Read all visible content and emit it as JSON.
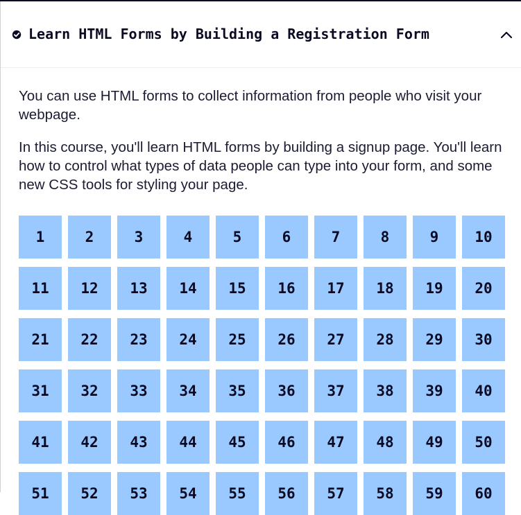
{
  "header": {
    "title": "Learn HTML Forms by Building a Registration Form",
    "status_icon": "check-circle-icon",
    "toggle_icon": "chevron-up-icon"
  },
  "description": {
    "paragraphs": [
      "You can use HTML forms to collect information from people who visit your webpage.",
      "In this course, you'll learn HTML forms by building a signup page. You'll learn how to control what types of data people can type into your form, and some new CSS tools for styling your page."
    ]
  },
  "steps": [
    "1",
    "2",
    "3",
    "4",
    "5",
    "6",
    "7",
    "8",
    "9",
    "10",
    "11",
    "12",
    "13",
    "14",
    "15",
    "16",
    "17",
    "18",
    "19",
    "20",
    "21",
    "22",
    "23",
    "24",
    "25",
    "26",
    "27",
    "28",
    "29",
    "30",
    "31",
    "32",
    "33",
    "34",
    "35",
    "36",
    "37",
    "38",
    "39",
    "40",
    "41",
    "42",
    "43",
    "44",
    "45",
    "46",
    "47",
    "48",
    "49",
    "50",
    "51",
    "52",
    "53",
    "54",
    "55",
    "56",
    "57",
    "58",
    "59",
    "60"
  ],
  "colors": {
    "step_bg": "#99c9ff",
    "text_dark": "#0a0a23",
    "accent": "#0a0a23"
  }
}
